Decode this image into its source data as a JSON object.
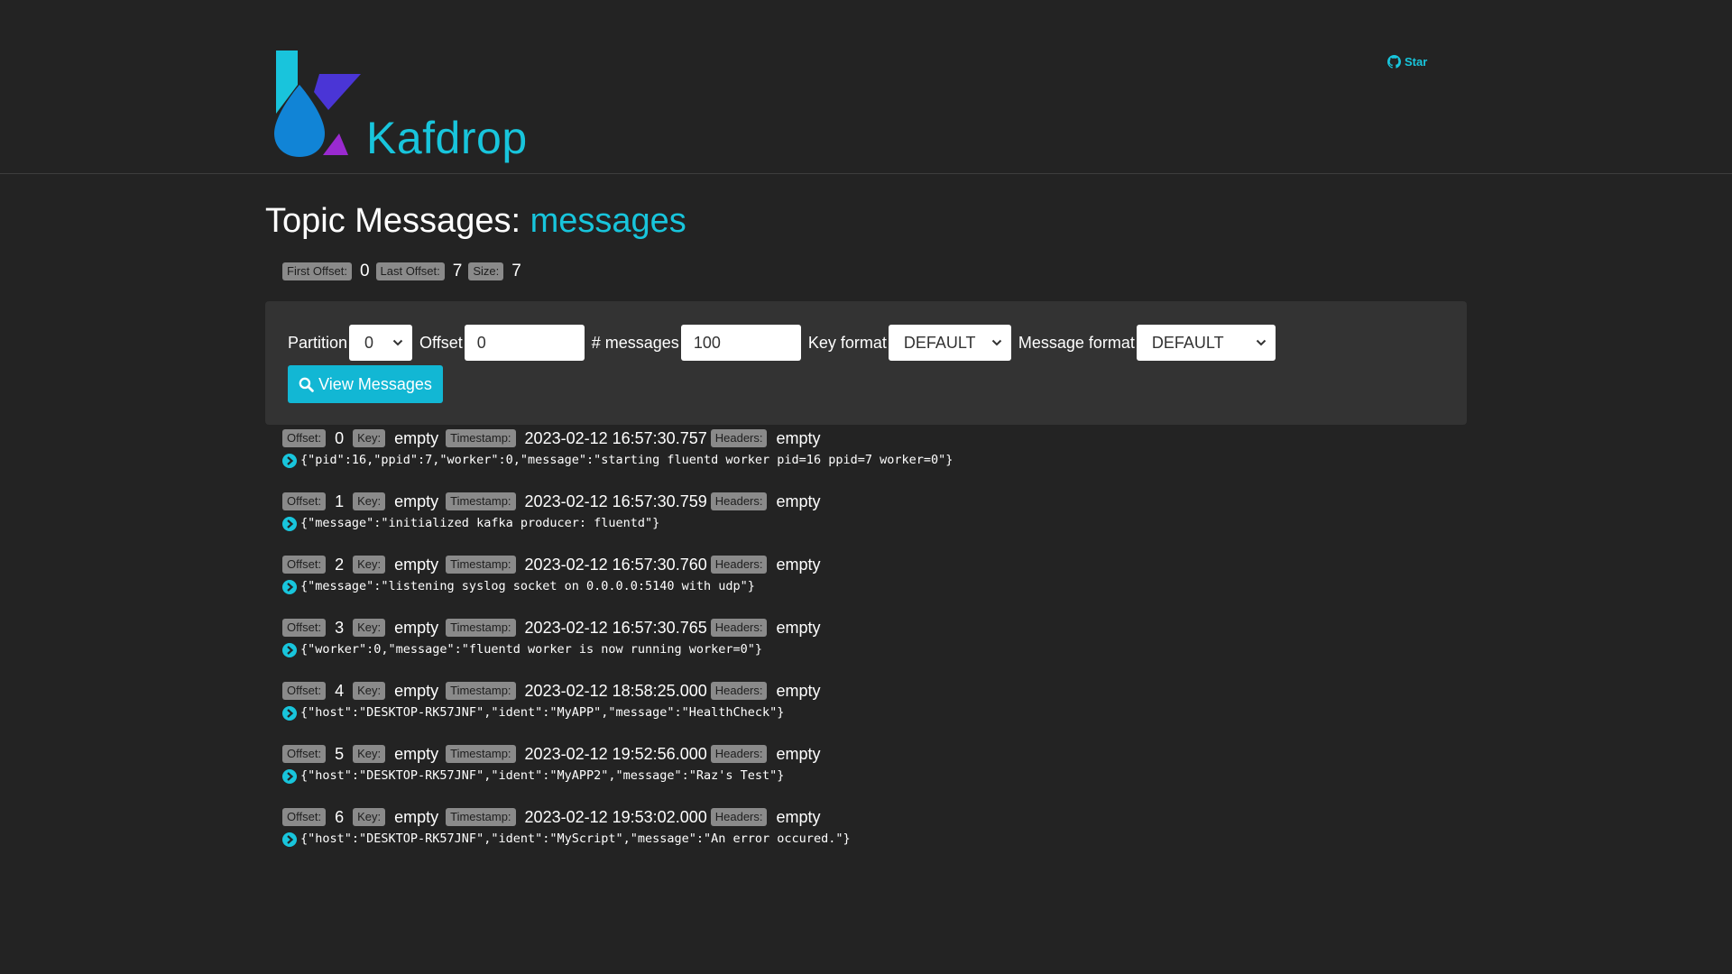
{
  "header": {
    "brand": "Kafdrop",
    "github_star_label": "Star"
  },
  "page": {
    "title_prefix": "Topic Messages:",
    "topic_name": "messages"
  },
  "stats": {
    "first_offset_label": "First Offset:",
    "first_offset": "0",
    "last_offset_label": "Last Offset:",
    "last_offset": "7",
    "size_label": "Size:",
    "size": "7"
  },
  "form": {
    "partition_label": "Partition",
    "partition_value": "0",
    "offset_label": "Offset",
    "offset_value": "0",
    "num_messages_label": "# messages",
    "num_messages_value": "100",
    "key_format_label": "Key format",
    "key_format_value": "DEFAULT",
    "message_format_label": "Message format",
    "message_format_value": "DEFAULT",
    "view_button_label": "View Messages"
  },
  "labels": {
    "offset": "Offset:",
    "key": "Key:",
    "timestamp": "Timestamp:",
    "headers": "Headers:"
  },
  "messages": [
    {
      "offset": "0",
      "key": "empty",
      "timestamp": "2023-02-12 16:57:30.757",
      "headers": "empty",
      "payload": "{\"pid\":16,\"ppid\":7,\"worker\":0,\"message\":\"starting fluentd worker pid=16 ppid=7 worker=0\"}"
    },
    {
      "offset": "1",
      "key": "empty",
      "timestamp": "2023-02-12 16:57:30.759",
      "headers": "empty",
      "payload": "{\"message\":\"initialized kafka producer: fluentd\"}"
    },
    {
      "offset": "2",
      "key": "empty",
      "timestamp": "2023-02-12 16:57:30.760",
      "headers": "empty",
      "payload": "{\"message\":\"listening syslog socket on 0.0.0.0:5140 with udp\"}"
    },
    {
      "offset": "3",
      "key": "empty",
      "timestamp": "2023-02-12 16:57:30.765",
      "headers": "empty",
      "payload": "{\"worker\":0,\"message\":\"fluentd worker is now running worker=0\"}"
    },
    {
      "offset": "4",
      "key": "empty",
      "timestamp": "2023-02-12 18:58:25.000",
      "headers": "empty",
      "payload": "{\"host\":\"DESKTOP-RK57JNF\",\"ident\":\"MyAPP\",\"message\":\"HealthCheck\"}"
    },
    {
      "offset": "5",
      "key": "empty",
      "timestamp": "2023-02-12 19:52:56.000",
      "headers": "empty",
      "payload": "{\"host\":\"DESKTOP-RK57JNF\",\"ident\":\"MyAPP2\",\"message\":\"Raz's Test\"}"
    },
    {
      "offset": "6",
      "key": "empty",
      "timestamp": "2023-02-12 19:53:02.000",
      "headers": "empty",
      "payload": "{\"host\":\"DESKTOP-RK57JNF\",\"ident\":\"MyScript\",\"message\":\"An error occured.\"}"
    }
  ],
  "colors": {
    "background": "#232323",
    "accent": "#18c5dc",
    "panel": "#333333",
    "badge": "#8a8a8a",
    "button": "#12b7d4"
  },
  "icons": {
    "logo": "kafdrop-logo",
    "github": "github-icon",
    "search": "search-icon",
    "expand": "chevron-circle-right-icon",
    "select": "chevron-down-icon"
  }
}
